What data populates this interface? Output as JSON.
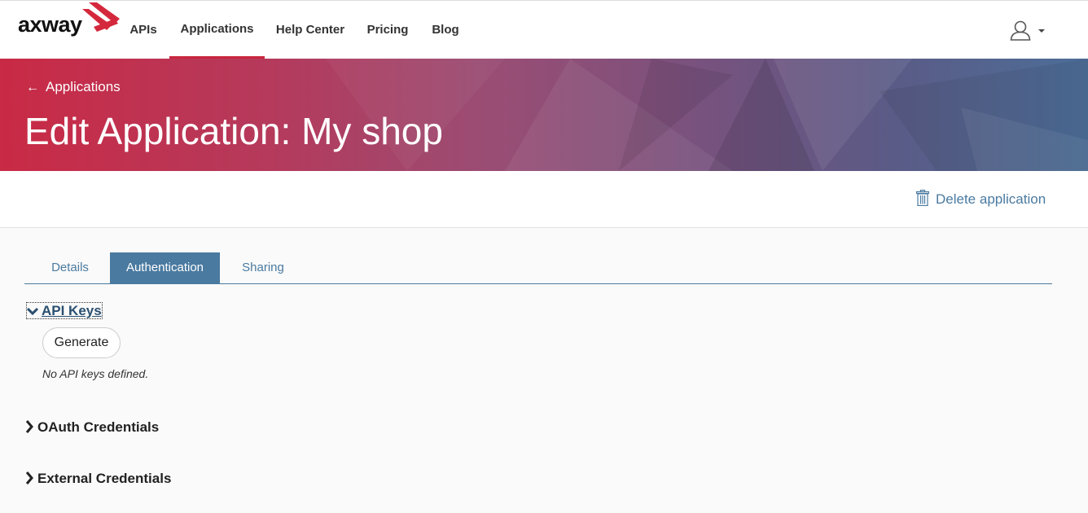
{
  "nav": {
    "logo": "axway",
    "items": [
      {
        "label": "APIs",
        "active": false
      },
      {
        "label": "Applications",
        "active": true
      },
      {
        "label": "Help Center",
        "active": false
      },
      {
        "label": "Pricing",
        "active": false
      },
      {
        "label": "Blog",
        "active": false
      }
    ],
    "user_icon": "user-icon"
  },
  "banner": {
    "back_label": "Applications",
    "title": "Edit Application: My shop"
  },
  "actions": {
    "delete_label": "Delete application"
  },
  "tabs": [
    {
      "label": "Details",
      "active": false
    },
    {
      "label": "Authentication",
      "active": true
    },
    {
      "label": "Sharing",
      "active": false
    }
  ],
  "sections": {
    "api_keys": {
      "title": "API Keys",
      "expanded": true,
      "generate_label": "Generate",
      "empty_text": "No API keys defined."
    },
    "oauth": {
      "title": "OAuth Credentials",
      "expanded": false
    },
    "external": {
      "title": "External Credentials",
      "expanded": false
    }
  },
  "colors": {
    "accent": "#c8263d",
    "link": "#4a7aa0",
    "tab_active_bg": "#4a7aa0"
  }
}
